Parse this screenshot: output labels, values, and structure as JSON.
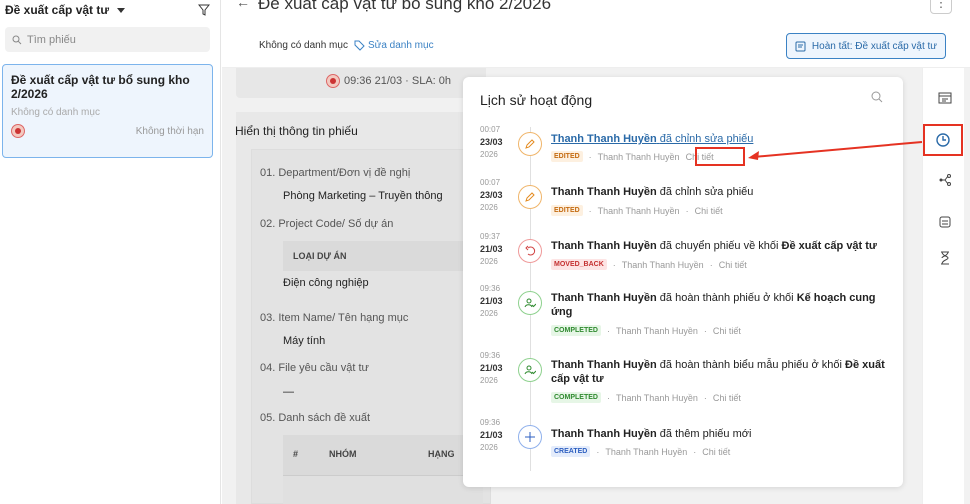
{
  "left": {
    "title": "Đề xuất cấp vật tư",
    "search_placeholder": "Tìm phiếu",
    "card": {
      "title": "Đề xuất cấp vật tư bổ sung kho 2/2026",
      "category": "Không có danh mục",
      "deadline": "Không thời hạn"
    }
  },
  "header": {
    "title": "Đề xuất cấp vật tư bổ sung kho 2/2026",
    "category": "Không có danh mục",
    "edit_category": "Sửa danh mục",
    "complete_button": "Hoàn tất: Đề xuất cấp vật tư"
  },
  "background": {
    "time": "09:36 21/03 · SLA: 0h",
    "section_title": "Hiển thị thông tin phiếu",
    "fields": [
      {
        "label": "01. Department/Đơn vị đề nghị",
        "value": "Phòng Marketing – Truyền thông"
      },
      {
        "label": "02. Project Code/ Số dự án",
        "col": "LOẠI DỰ ÁN",
        "value": "Điện công nghiệp"
      },
      {
        "label": "03. Item Name/ Tên hạng mục",
        "value": "Máy tính"
      },
      {
        "label": "04. File yêu cầu vật tư",
        "value": "—"
      },
      {
        "label": "05. Danh sách đề xuất",
        "cols": [
          "#",
          "NHÓM",
          "HẠNG"
        ]
      }
    ]
  },
  "activity": {
    "title": "Lịch sử hoạt động",
    "events": [
      {
        "time": "00:07",
        "date": "23/03",
        "year": "2026",
        "user": "Thanh Thanh Huyền",
        "action": "đã chỉnh sửa phiếu",
        "target": "",
        "tag": "EDITED",
        "by": "Thanh Thanh Huyền",
        "detail": "Chi tiết"
      },
      {
        "time": "00:07",
        "date": "23/03",
        "year": "2026",
        "user": "Thanh Thanh Huyền",
        "action": "đã chỉnh sửa phiếu",
        "target": "",
        "tag": "EDITED",
        "by": "Thanh Thanh Huyền",
        "detail": "Chi tiết"
      },
      {
        "time": "09:37",
        "date": "21/03",
        "year": "2026",
        "user": "Thanh Thanh Huyền",
        "action": "đã chuyển phiếu về khối",
        "target": "Đề xuất cấp vật tư",
        "tag": "MOVED_BACK",
        "by": "Thanh Thanh Huyền",
        "detail": "Chi tiết"
      },
      {
        "time": "09:36",
        "date": "21/03",
        "year": "2026",
        "user": "Thanh Thanh Huyền",
        "action": "đã hoàn thành phiếu ở khối",
        "target": "Kế hoạch cung ứng",
        "tag": "COMPLETED",
        "by": "Thanh Thanh Huyền",
        "detail": "Chi tiết"
      },
      {
        "time": "09:36",
        "date": "21/03",
        "year": "2026",
        "user": "Thanh Thanh Huyền",
        "action": "đã hoàn thành biểu mẫu phiếu ở khối",
        "target": "Đề xuất cấp vật tư",
        "tag": "COMPLETED",
        "by": "Thanh Thanh Huyền",
        "detail": "Chi tiết"
      },
      {
        "time": "09:36",
        "date": "21/03",
        "year": "2026",
        "user": "Thanh Thanh Huyền",
        "action": "đã thêm phiếu mới",
        "target": "",
        "tag": "CREATED",
        "by": "Thanh Thanh Huyền",
        "detail": "Chi tiết"
      }
    ]
  },
  "colors": {
    "accent": "#3b82c4",
    "highlight": "#e53222"
  }
}
